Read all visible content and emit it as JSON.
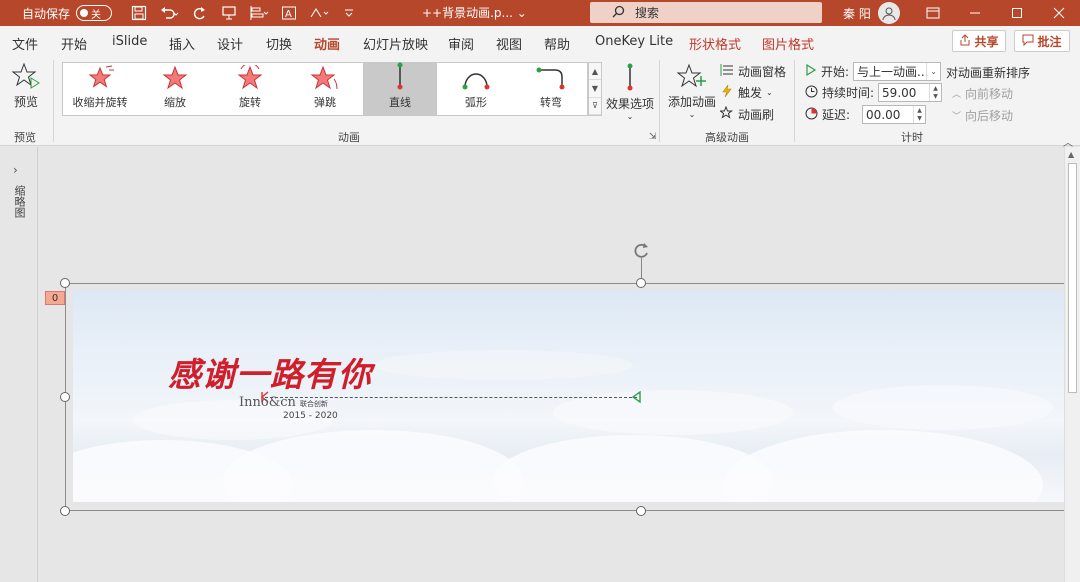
{
  "titlebar": {
    "autosave_label": "自动保存",
    "autosave_state": "关",
    "doc_title": "++背景动画.p... ⌄",
    "search_placeholder": "搜索",
    "user_name": "秦 阳",
    "colors": {
      "accent": "#b7472a"
    }
  },
  "menu": {
    "tabs": [
      "文件",
      "开始",
      "iSlide",
      "插入",
      "设计",
      "切换",
      "动画",
      "幻灯片放映",
      "审阅",
      "视图",
      "帮助",
      "OneKey Lite",
      "形状格式",
      "图片格式"
    ],
    "active_tab": "动画",
    "share_label": "共享",
    "comment_label": "批注"
  },
  "ribbon": {
    "preview": {
      "button_label": "预览",
      "group_label": "预览"
    },
    "animation": {
      "group_label": "动画",
      "gallery": [
        {
          "label": "收缩并旋转",
          "icon": "star-shrink-spin-icon"
        },
        {
          "label": "缩放",
          "icon": "star-zoom-icon"
        },
        {
          "label": "旋转",
          "icon": "star-spin-icon"
        },
        {
          "label": "弹跳",
          "icon": "star-bounce-icon"
        },
        {
          "label": "直线",
          "icon": "line-path-icon",
          "selected": true
        },
        {
          "label": "弧形",
          "icon": "arc-path-icon"
        },
        {
          "label": "转弯",
          "icon": "turn-path-icon"
        }
      ],
      "effect_options_label": "效果选项"
    },
    "advanced": {
      "group_label": "高级动画",
      "add_animation_label": "添加动画",
      "animation_pane_label": "动画窗格",
      "trigger_label": "触发",
      "painter_label": "动画刷"
    },
    "timing": {
      "group_label": "计时",
      "start_label": "开始:",
      "start_value": "与上一动画...",
      "duration_label": "持续时间:",
      "duration_value": "59.00",
      "delay_label": "延迟:",
      "delay_value": "00.00",
      "reorder_label": "对动画重新排序",
      "move_earlier_label": "向前移动",
      "move_later_label": "向后移动"
    }
  },
  "workspace": {
    "thumbnails_label": "缩略图",
    "animation_tag": "0",
    "slide": {
      "title": "感谢一路有你",
      "brand": "Inno&cn",
      "brand_cn": "联合创新",
      "years": "2015 - 2020"
    }
  }
}
